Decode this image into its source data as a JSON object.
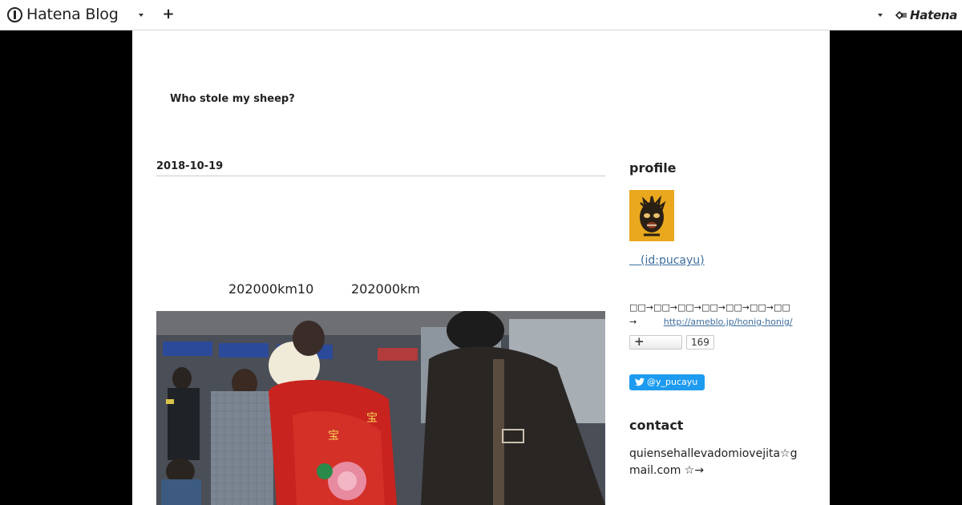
{
  "topbar": {
    "logo_text": "Hatena Blog",
    "plus_label": "+",
    "brand_right": "Hatena"
  },
  "blog": {
    "title": "Who stole my sheep?"
  },
  "entry": {
    "date": "2018-10-19",
    "text_parts": [
      "202000km10",
      "202000km"
    ]
  },
  "sidebar": {
    "profile_heading": "profile",
    "profile_link": "　(id:pucayu)",
    "profile_desc": "□□→□□→□□→□□→□□→□□→□□",
    "profile_arrow": "→",
    "profile_url": "http://ameblo.jp/honig-honig/",
    "subscribe_plus": "+",
    "subscribe_count": "169",
    "twitter_handle": "@y_pucayu",
    "contact_heading": "contact",
    "contact_text": "quiensehallevadomiovejita☆gmail.com ☆→"
  },
  "colors": {
    "link": "#3d6e9e",
    "twitter": "#1d9bf0",
    "avatar_bg": "#e9a81e",
    "page_bg": "#000000"
  },
  "icons": [
    "hatena-logo-icon",
    "chevron-down-icon",
    "plus-icon",
    "hatena-brand-icon",
    "twitter-bird-icon"
  ]
}
